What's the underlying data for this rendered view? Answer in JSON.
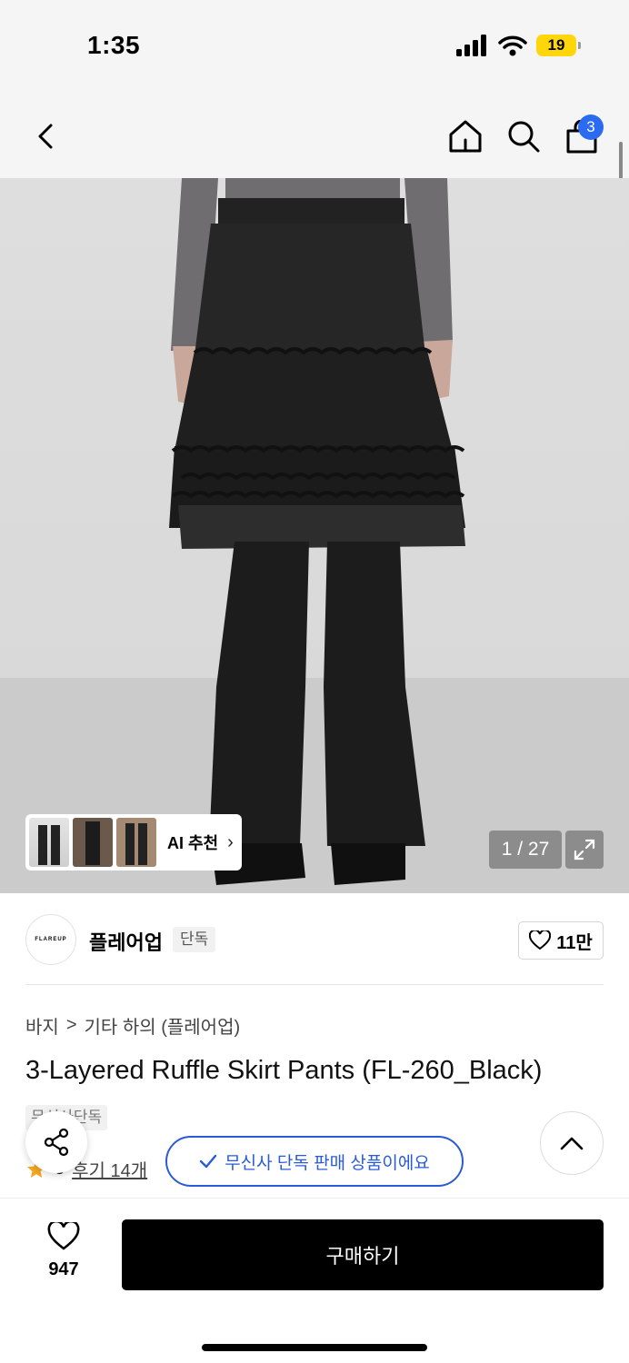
{
  "status": {
    "time": "1:35",
    "battery": "19"
  },
  "nav": {
    "back_icon": "chevron-left-icon",
    "cart_count": "3"
  },
  "gallery": {
    "counter": "1 / 27",
    "ai_label": "AI 추천"
  },
  "brand": {
    "name": "플레어업",
    "logo_text": "FLAREUP",
    "tag": "단독",
    "likes": "11만"
  },
  "breadcrumb": {
    "category": "바지",
    "separator": ">",
    "subcategory": "기타 하의 (플레어업)"
  },
  "product": {
    "title": "3-Layered Ruffle Skirt Pants (FL-260_Black)",
    "exclusive_tag": "무신사단독",
    "rating": "5",
    "reviews": "후기 14개"
  },
  "toast": {
    "text": "무신사 단독 판매 상품이에요"
  },
  "bottom": {
    "wish_count": "947",
    "buy_label": "구매하기"
  },
  "colors": {
    "accent_blue": "#2a5bd7",
    "badge_blue": "#2a6bf2",
    "battery_yellow": "#ffd60a",
    "star": "#f5a623"
  }
}
